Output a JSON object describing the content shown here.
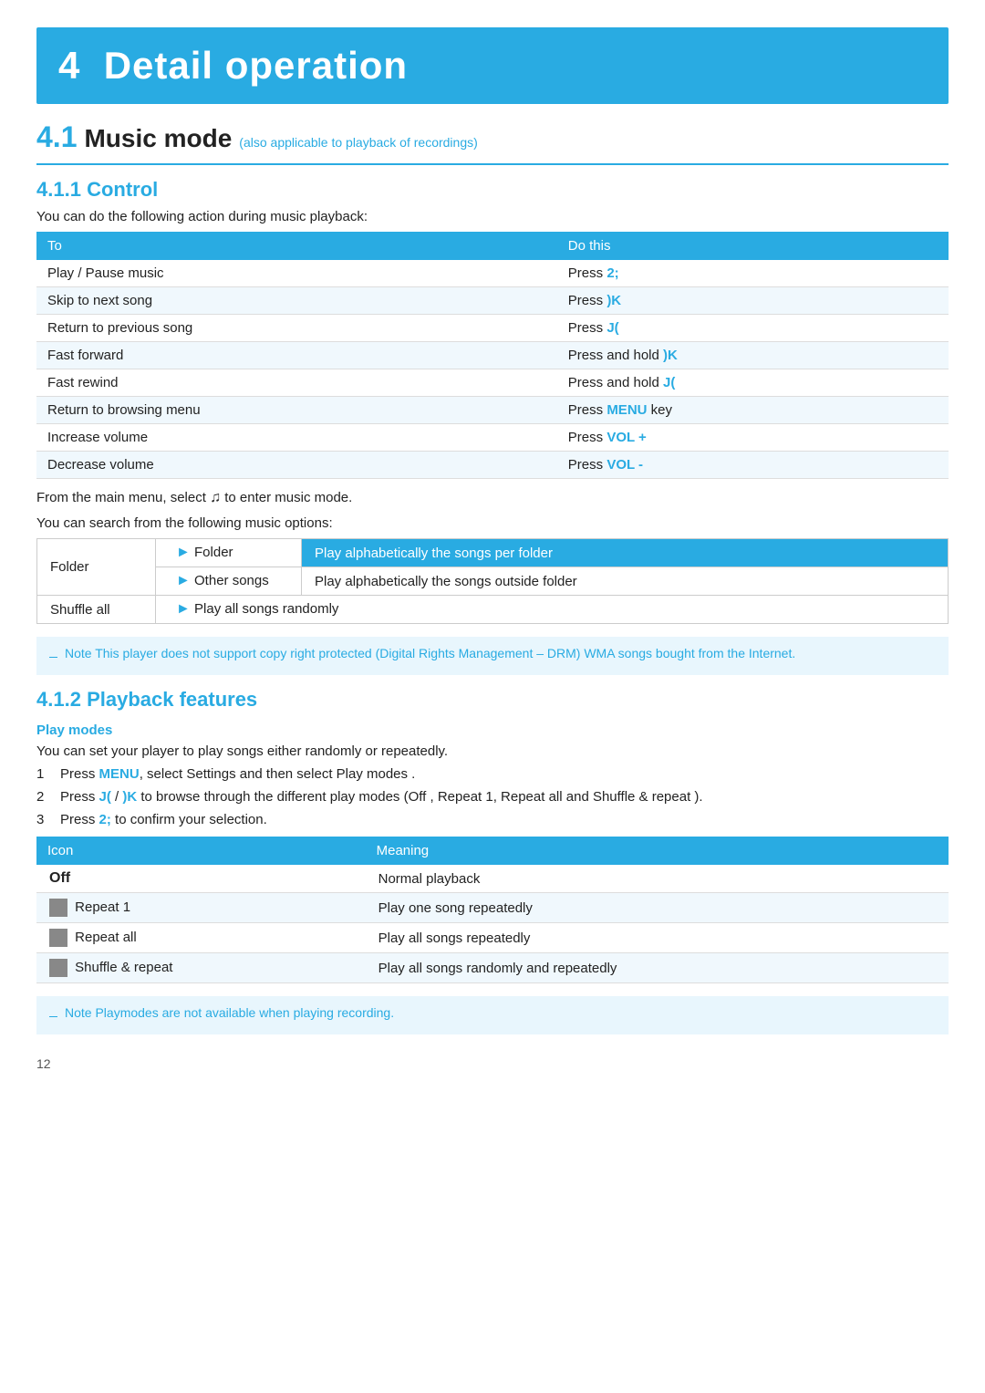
{
  "chapter": {
    "number": "4",
    "title": "Detail operation"
  },
  "section41": {
    "number": "4.1",
    "title": "Music mode",
    "subtitle": "(also applicable to playback of recordings)"
  },
  "section411": {
    "number": "4.1.1",
    "title": "Control",
    "intro": "You can do the following action during music playback:",
    "table_headers": [
      "To",
      "Do this"
    ],
    "table_rows": [
      [
        "Play / Pause music",
        "Press 2;"
      ],
      [
        "Skip to next song",
        "Press )K"
      ],
      [
        "Return to previous song",
        "Press J("
      ],
      [
        "Fast forward",
        "Press and hold )K"
      ],
      [
        "Fast rewind",
        "Press and hold J("
      ],
      [
        "Return to browsing menu",
        "Press MENU key"
      ],
      [
        "Increase volume",
        "Press VOL +"
      ],
      [
        "Decrease volume",
        "Press VOL -"
      ]
    ],
    "after_table": "From the main menu, select ♫ to enter music mode.",
    "search_intro": "You can search from the following music options:",
    "options_col1_r1": "Folder",
    "options_col2_r1": "Folder",
    "options_col3_r1": "Play alphabetically the songs per folder",
    "options_col2_r2": "Other songs",
    "options_col3_r2": "Play alphabetically the songs outside folder",
    "options_col1_r3": "Shuffle all",
    "options_col2_r3": "Play all songs randomly",
    "note1": "Note  This player does not support copy right protected (Digital Rights Management – DRM) WMA songs bought from the Internet."
  },
  "section412": {
    "number": "4.1.2",
    "title": "Playback features",
    "play_modes_label": "Play modes",
    "play_modes_intro": "You can set your player to play songs either randomly or repeatedly.",
    "steps": [
      {
        "num": "1",
        "text": "Press MENU, select Settings  and then select Play modes ."
      },
      {
        "num": "2",
        "text": "Press J(  / )K  to browse through the different play modes (Off , Repeat 1,  Repeat all  and Shuffle & repeat )."
      },
      {
        "num": "3",
        "text": "Press 2;   to confirm your selection."
      }
    ],
    "icon_table_headers": [
      "Icon",
      "Meaning"
    ],
    "icon_table_rows": [
      {
        "icon": "Off",
        "icon_type": "text",
        "meaning": "Normal playback"
      },
      {
        "icon": "Repeat 1",
        "icon_type": "square",
        "meaning": "Play one song repeatedly"
      },
      {
        "icon": "Repeat all",
        "icon_type": "square",
        "meaning": "Play all songs repeatedly"
      },
      {
        "icon": "Shuffle & repeat",
        "icon_type": "square",
        "meaning": "Play all songs randomly and repeatedly"
      }
    ],
    "note2": "Note  Playmodes are not available when playing recording."
  },
  "page_number": "12",
  "highlight_color": "#29abe2"
}
